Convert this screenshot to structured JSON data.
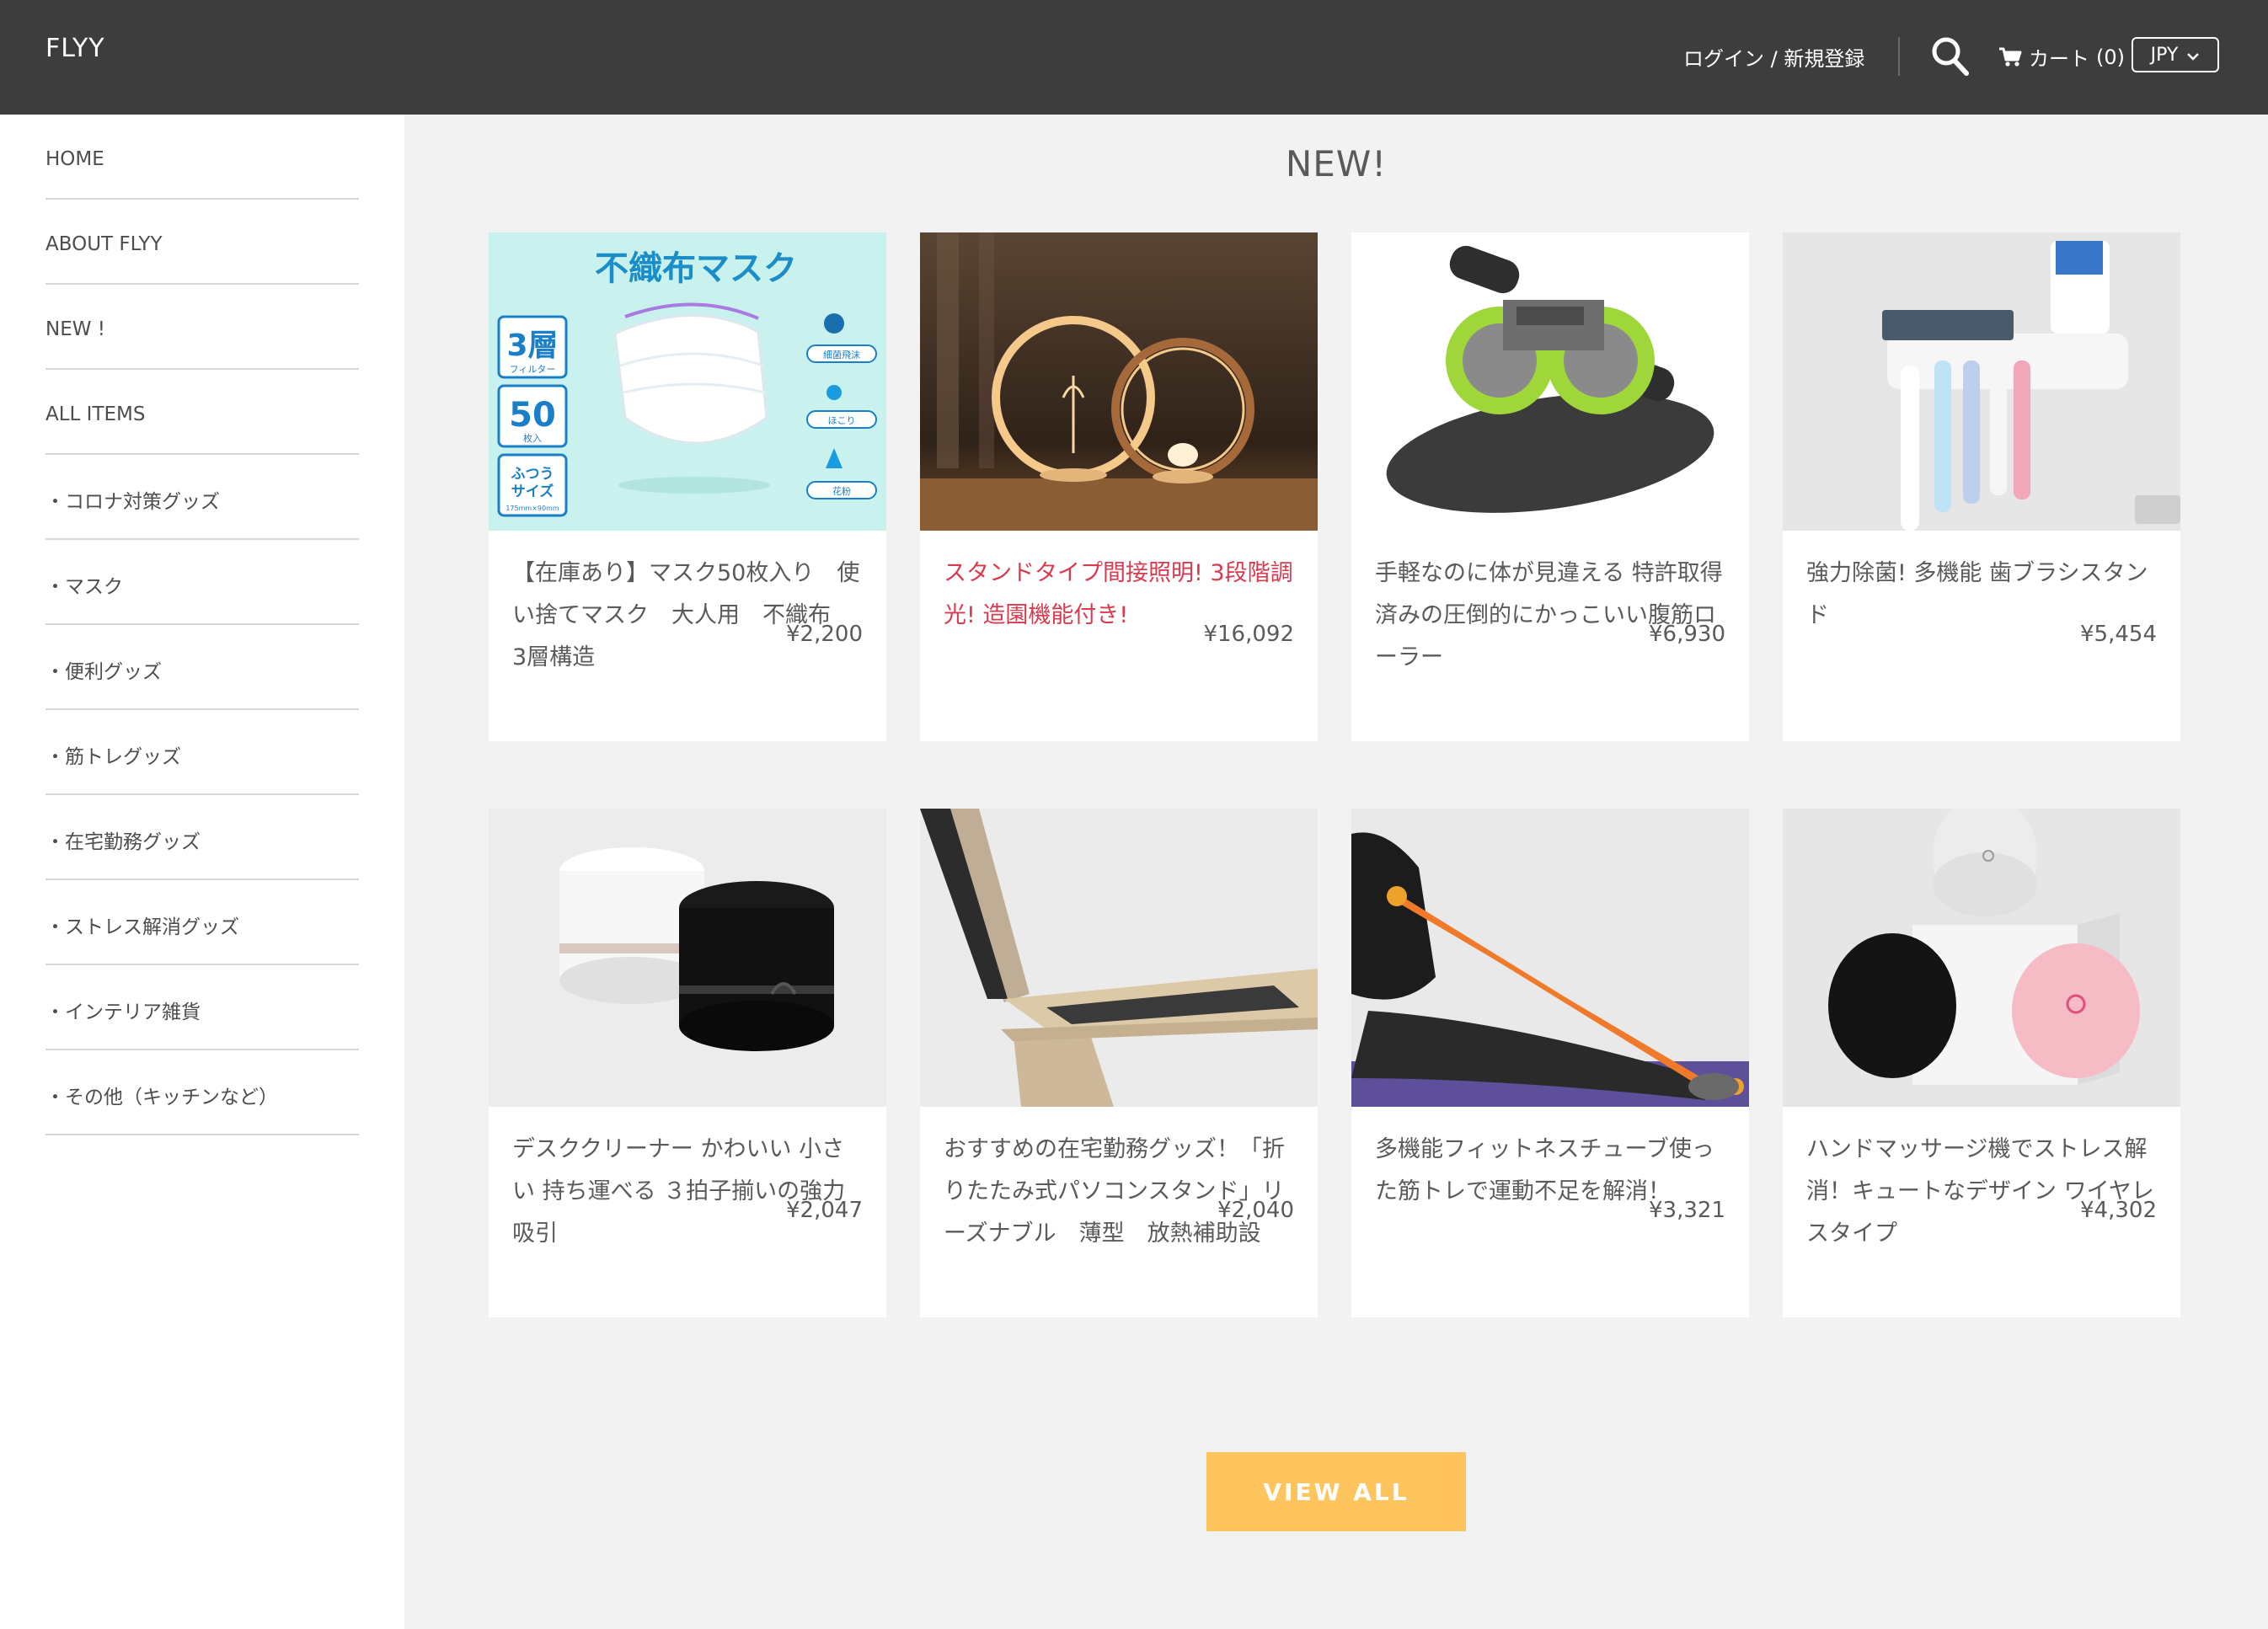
{
  "header": {
    "logo": "FLYY",
    "login": "ログイン / 新規登録",
    "cart_label": "カート",
    "cart_count": "(0)",
    "currency": "JPY"
  },
  "sidebar": {
    "items": [
      {
        "label": "HOME"
      },
      {
        "label": "ABOUT FLYY"
      },
      {
        "label": "NEW !"
      },
      {
        "label": "ALL ITEMS"
      },
      {
        "label": "・コロナ対策グッズ"
      },
      {
        "label": "・マスク"
      },
      {
        "label": "・便利グッズ"
      },
      {
        "label": "・筋トレグッズ"
      },
      {
        "label": "・在宅勤務グッズ"
      },
      {
        "label": "・ストレス解消グッズ"
      },
      {
        "label": "・インテリア雑貨"
      },
      {
        "label": "・その他（キッチンなど）"
      }
    ]
  },
  "main": {
    "section_title": "NEW!",
    "products": [
      {
        "title": "【在庫あり】マスク50枚入り　使い捨てマスク　大人用　不織布　3層構造",
        "price": "¥2,200",
        "image": "mask-box"
      },
      {
        "title": "スタンドタイプ間接照明! 3段階調光! 造園機能付き!",
        "price": "¥16,092",
        "image": "ring-lamp",
        "highlight": "#d83b4e"
      },
      {
        "title": "手軽なのに体が見違える 特許取得済みの圧倒的にかっこいい腹筋ローラー",
        "price": "¥6,930",
        "image": "ab-roller"
      },
      {
        "title": "強力除菌! 多機能 歯ブラシスタンド",
        "price": "¥5,454",
        "image": "toothbrush-holder"
      },
      {
        "title": "デスククリーナー かわいい 小さい 持ち運べる ３拍子揃いの強力吸引",
        "price": "¥2,047",
        "image": "desk-cleaner"
      },
      {
        "title": "おすすめの在宅勤務グッズ！「折りたたみ式パソコンスタンド」リーズナブル　薄型　放熱補助設",
        "price": "¥2,040",
        "image": "laptop-stand"
      },
      {
        "title": "多機能フィットネスチューブ使った筋トレで運動不足を解消！",
        "price": "¥3,321",
        "image": "fitness-tube"
      },
      {
        "title": "ハンドマッサージ機でストレス解消！キュートなデザイン ワイヤレスタイプ",
        "price": "¥4,302",
        "image": "hand-massager"
      }
    ],
    "view_all": "VIEW ALL"
  },
  "mask_box": {
    "heading": "不織布マスク",
    "badge1": "3層",
    "badge1_sub": "フィルター",
    "badge2": "50",
    "badge2_sub": "枚入",
    "badge3": "ふつう\nサイズ",
    "badge3_sub": "175mm×90mm",
    "icon1": "細菌飛沫",
    "icon2": "ほこり",
    "icon3": "花粉"
  },
  "colors": {
    "header_bg": "#3d3d3d",
    "accent": "#fec55f",
    "highlight": "#d83b4e",
    "page_bg": "#f2f2f2"
  }
}
